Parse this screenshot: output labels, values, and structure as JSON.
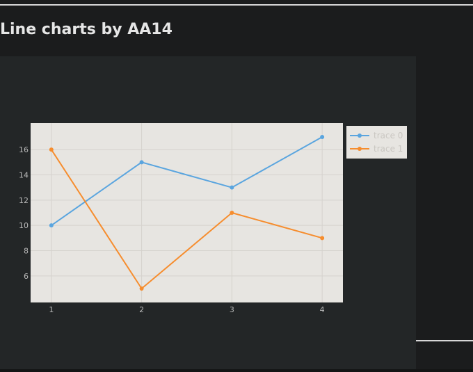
{
  "page": {
    "title": "Line charts by AA14"
  },
  "chart_data": {
    "type": "line",
    "title": "",
    "xlabel": "",
    "ylabel": "",
    "x": [
      1,
      2,
      3,
      4
    ],
    "series": [
      {
        "name": "trace 0",
        "values": [
          10,
          15,
          13,
          17
        ],
        "color": "#5aa5df"
      },
      {
        "name": "trace 1",
        "values": [
          16,
          5,
          11,
          9
        ],
        "color": "#f68d2e"
      }
    ],
    "xticks": [
      1,
      2,
      3,
      4
    ],
    "yticks": [
      6,
      8,
      10,
      12,
      14,
      16
    ],
    "xlim": [
      0.77,
      4.23
    ],
    "ylim": [
      3.9,
      18.1
    ],
    "grid": true,
    "legend_position": "top-right-outside",
    "colors": {
      "plot_background": "#e7e5e1",
      "legend_background": "#e7e5e1",
      "panel_background": "#232627",
      "page_background": "#1b1c1d"
    }
  }
}
